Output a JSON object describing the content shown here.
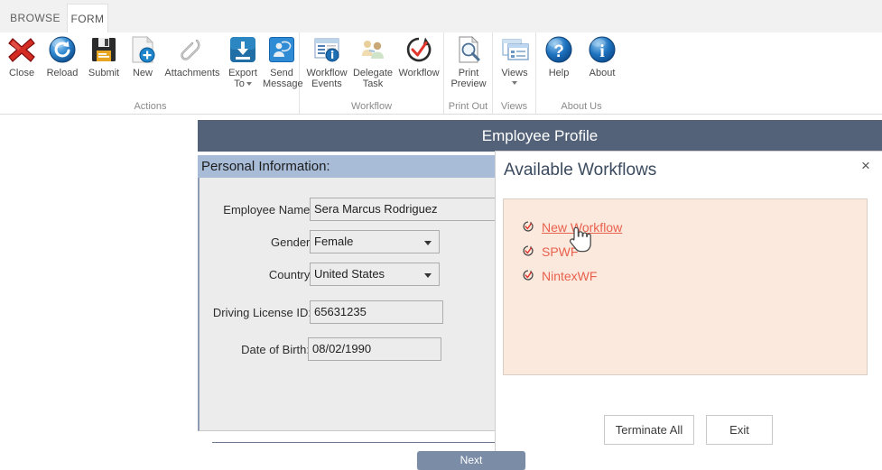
{
  "ribbon": {
    "tabs": [
      {
        "label": "BROWSE",
        "active": false
      },
      {
        "label": "FORM",
        "active": true
      }
    ],
    "groups": [
      {
        "label": "Actions",
        "buttons": [
          {
            "label": "Close",
            "icon": "close-x-icon"
          },
          {
            "label": "Reload",
            "icon": "reload-circular-arrow-icon"
          },
          {
            "label": "Submit",
            "icon": "floppy-disk-save-icon"
          },
          {
            "label": "New",
            "icon": "new-document-plus-icon"
          },
          {
            "label": "Attachments",
            "icon": "paperclip-icon"
          },
          {
            "label": "Export\nTo",
            "icon": "export-download-icon",
            "caret": true
          },
          {
            "label": "Send\nMessage",
            "icon": "send-message-icon"
          }
        ]
      },
      {
        "label": "Workflow",
        "buttons": [
          {
            "label": "Workflow\nEvents",
            "icon": "workflow-events-icon"
          },
          {
            "label": "Delegate\nTask",
            "icon": "delegate-task-icon"
          },
          {
            "label": "Workflow",
            "icon": "workflow-check-icon"
          }
        ]
      },
      {
        "label": "Print Out",
        "buttons": [
          {
            "label": "Print\nPreview",
            "icon": "print-preview-icon"
          }
        ]
      },
      {
        "label": "Views",
        "buttons": [
          {
            "label": "Views",
            "icon": "views-window-icon",
            "caret": true
          }
        ]
      },
      {
        "label": "About Us",
        "buttons": [
          {
            "label": "Help",
            "icon": "help-question-icon"
          },
          {
            "label": "About",
            "icon": "about-info-icon"
          }
        ]
      }
    ]
  },
  "form": {
    "title": "Employee Profile",
    "section_header": "Personal Information:",
    "fields": [
      {
        "label": "Employee Name:",
        "value": "Sera Marcus Rodriguez",
        "type": "text"
      },
      {
        "label": "Gender:",
        "value": "Female",
        "type": "select"
      },
      {
        "label": "Country:",
        "value": "United States",
        "type": "select"
      },
      {
        "label": "Driving License ID:",
        "value": "65631235",
        "type": "text"
      },
      {
        "label": "Date of Birth:",
        "value": "08/02/1990",
        "type": "text"
      }
    ],
    "next_label": "Next"
  },
  "dialog": {
    "title": "Available Workflows",
    "close_label": "×",
    "workflows": [
      {
        "label": "New Workflow",
        "hovered": true
      },
      {
        "label": "SPWF",
        "hovered": false
      },
      {
        "label": "NintexWF",
        "hovered": false
      }
    ],
    "buttons": [
      {
        "label": "Terminate All"
      },
      {
        "label": "Exit"
      }
    ]
  },
  "colors": {
    "title_bar": "#536278",
    "section_header": "#a8bcd8",
    "form_body": "#ececec",
    "workflow_box": "#fbe9dd",
    "workflow_link": "#e8614d",
    "next_button": "#7b8ca6",
    "tab_strip": "#f1f1f1"
  }
}
